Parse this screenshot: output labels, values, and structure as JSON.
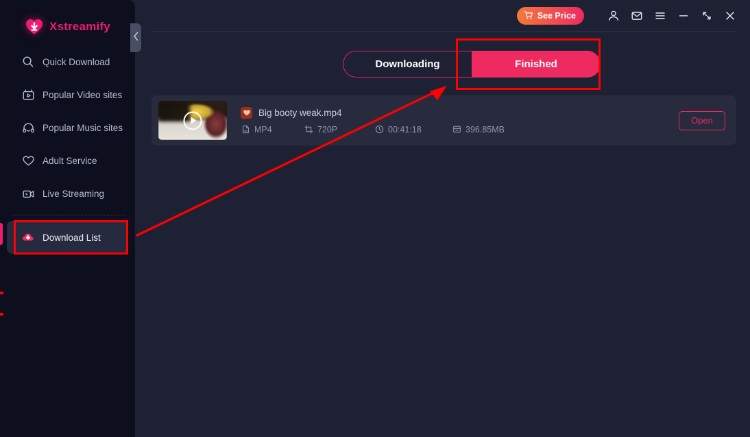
{
  "app": {
    "brand": "Xstreamify",
    "logo_icon": "heart-download-icon",
    "accent": "#ee1c6e",
    "gradient_start": "#f4793a",
    "gradient_end": "#ee2a60",
    "sidebar_bg": "#0d0e1e",
    "content_bg": "#1e2133",
    "card_bg": "#272b3d",
    "annotation_color": "#ff0000"
  },
  "sidebar": {
    "collapse_icon": "chevron-left-icon",
    "items": [
      {
        "label": "Quick Download",
        "icon": "search-icon",
        "active": false
      },
      {
        "label": "Popular Video sites",
        "icon": "video-box-icon",
        "active": false
      },
      {
        "label": "Popular Music sites",
        "icon": "headphones-icon",
        "active": false
      },
      {
        "label": "Adult Service",
        "icon": "heart-icon",
        "active": false
      },
      {
        "label": "Live Streaming",
        "icon": "live-camera-icon",
        "active": false
      },
      {
        "label": "Download List",
        "icon": "cloud-download-icon",
        "active": true
      }
    ]
  },
  "header": {
    "see_price_label": "See Price",
    "see_price_icon": "cart-icon",
    "icons": [
      {
        "name": "account-icon"
      },
      {
        "name": "mail-icon"
      },
      {
        "name": "menu-icon"
      },
      {
        "name": "minimize-icon"
      },
      {
        "name": "maximize-icon"
      },
      {
        "name": "close-icon"
      }
    ]
  },
  "tabs": {
    "downloading_label": "Downloading",
    "finished_label": "Finished",
    "active": "Finished"
  },
  "downloads": [
    {
      "title": "Big booty weak.mp4",
      "favicon": "site-heart-icon",
      "format": "MP4",
      "format_icon": "file-icon",
      "resolution": "720P",
      "resolution_icon": "crop-icon",
      "duration": "00:41:18",
      "duration_icon": "clock-icon",
      "size": "396.85MB",
      "size_icon": "archive-icon",
      "open_label": "Open",
      "play_icon": "play-circle-icon"
    }
  ]
}
